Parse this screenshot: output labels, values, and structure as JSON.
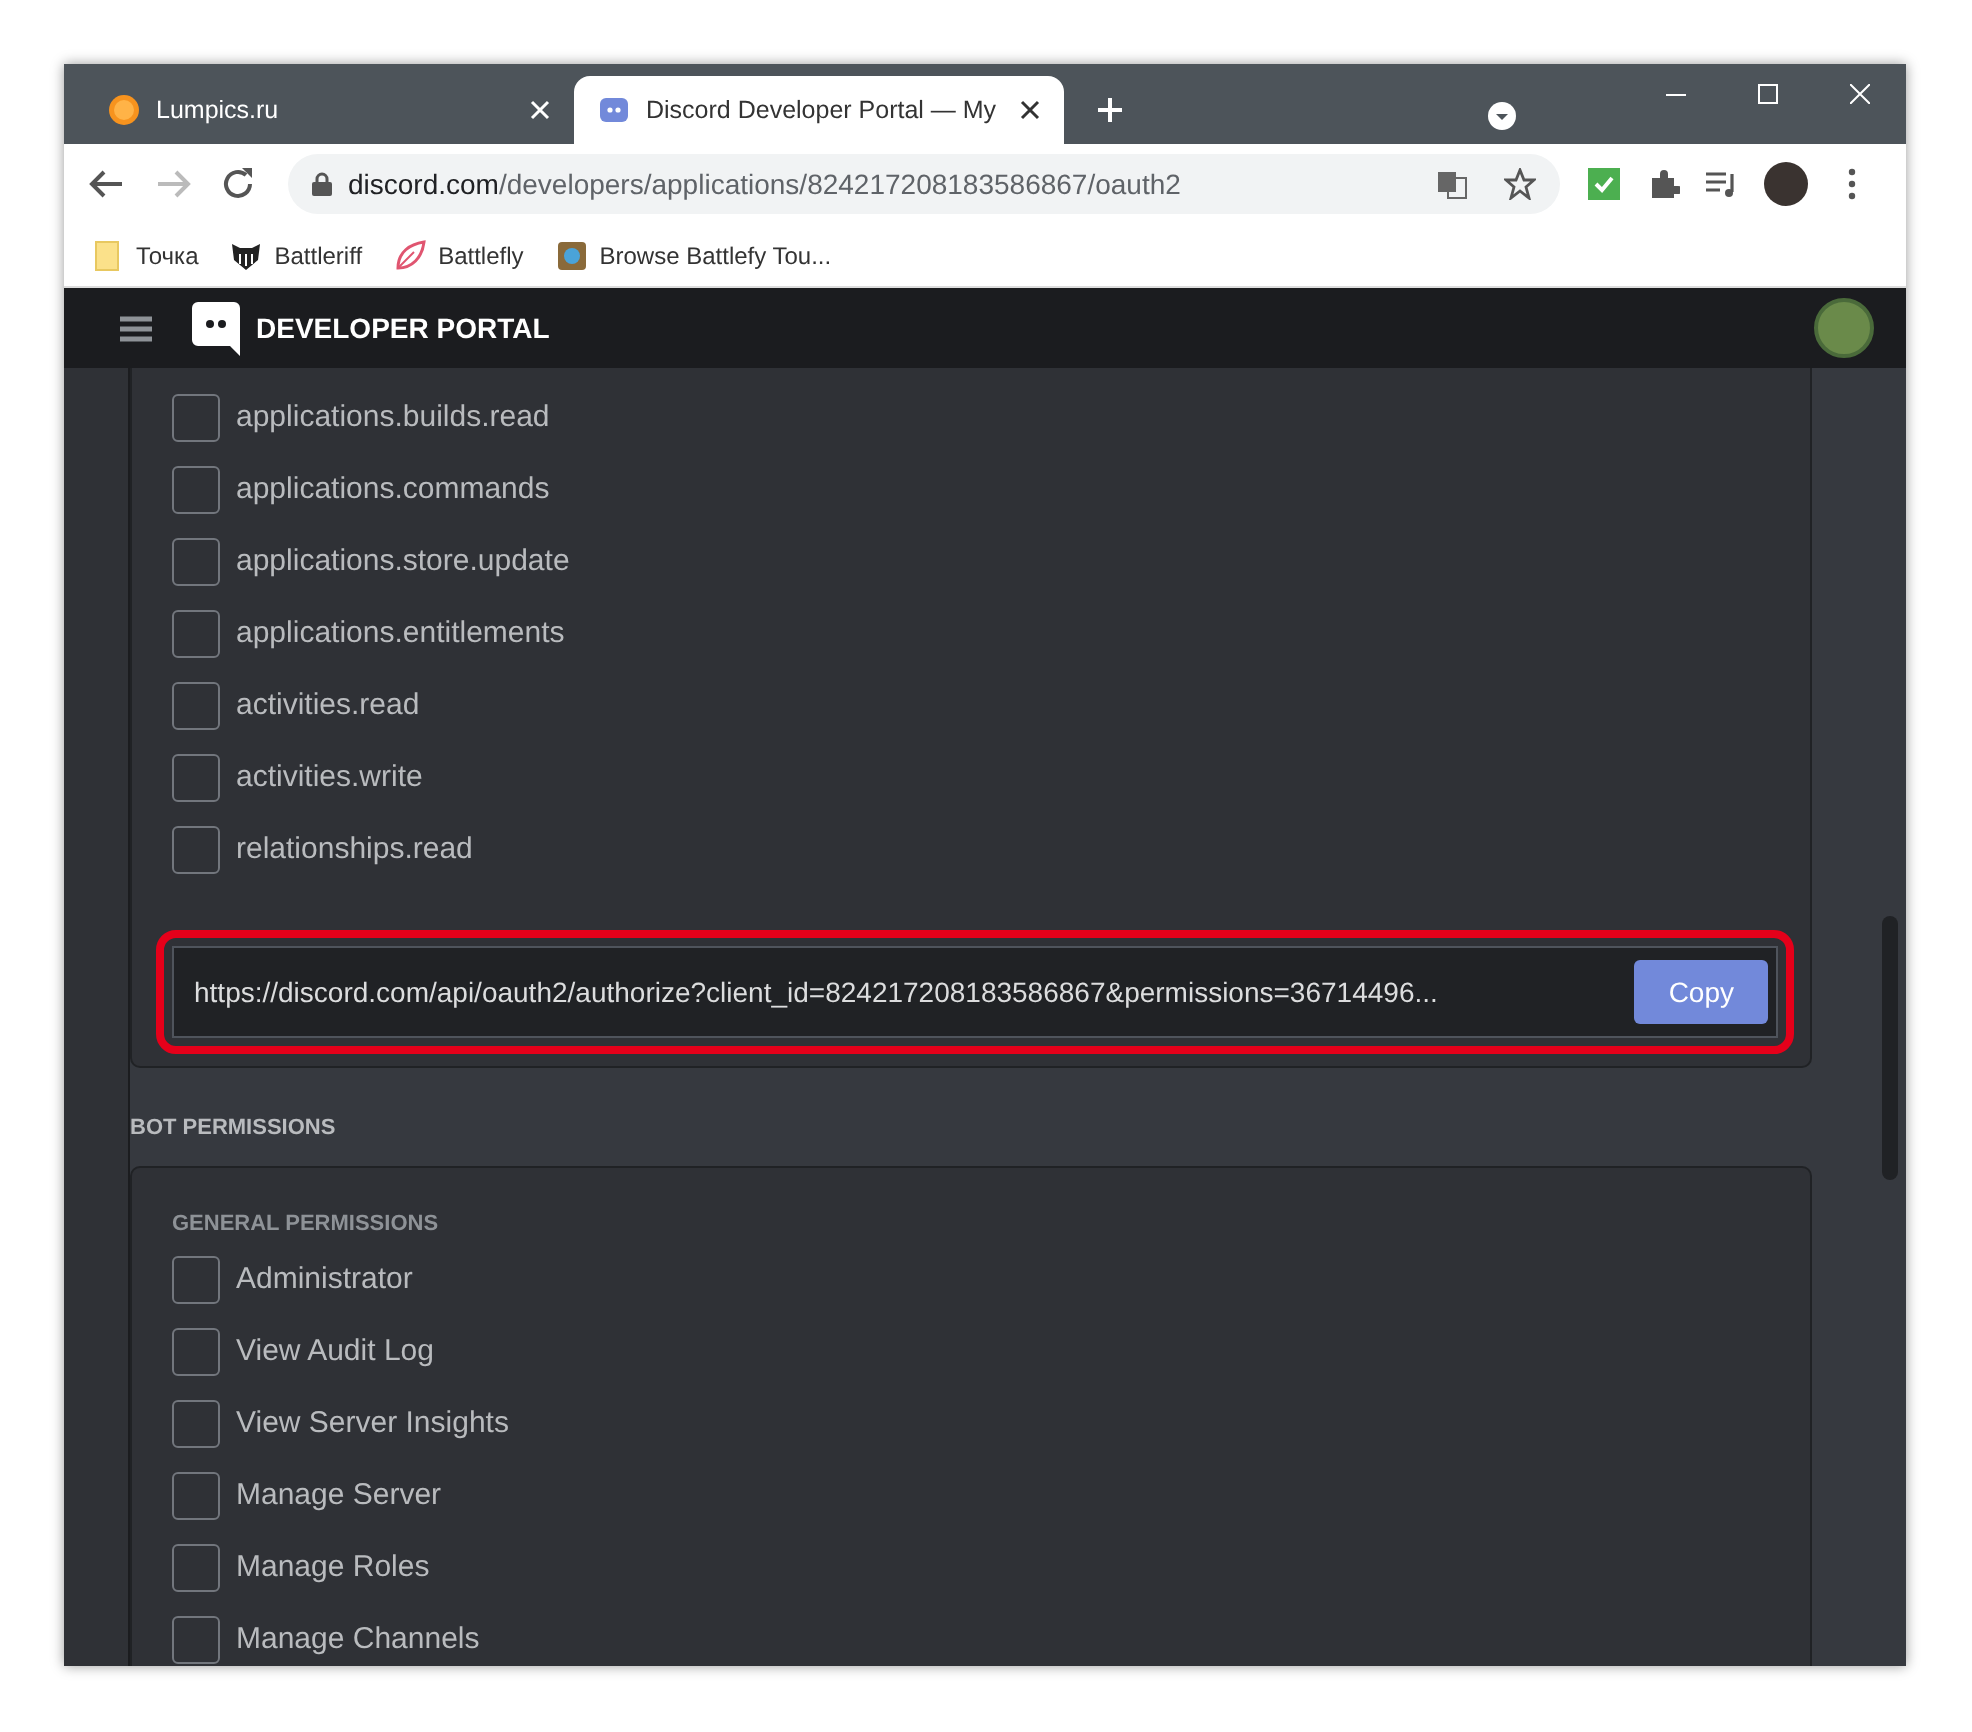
{
  "browser": {
    "tabs": [
      {
        "title": "Lumpics.ru",
        "selected": false
      },
      {
        "title": "Discord Developer Portal — My",
        "selected": true
      }
    ],
    "address": {
      "host": "discord.com",
      "path": "/developers/applications/824217208183586867/oauth2"
    },
    "bookmarks": [
      "Точка",
      "Battleriff",
      "Battlefly",
      "Browse Battlefy Tou..."
    ]
  },
  "header": {
    "title": "DEVELOPER PORTAL"
  },
  "scopes": [
    {
      "label": "applications.builds.read",
      "checked": false
    },
    {
      "label": "applications.commands",
      "checked": false
    },
    {
      "label": "applications.store.update",
      "checked": false
    },
    {
      "label": "applications.entitlements",
      "checked": false
    },
    {
      "label": "activities.read",
      "checked": false
    },
    {
      "label": "activities.write",
      "checked": false
    },
    {
      "label": "relationships.read",
      "checked": false
    }
  ],
  "generated_url": {
    "value": "https://discord.com/api/oauth2/authorize?client_id=824217208183586867&permissions=36714496...",
    "button": "Copy"
  },
  "bot_permissions": {
    "title": "BOT PERMISSIONS",
    "group_title": "GENERAL PERMISSIONS",
    "items": [
      {
        "label": "Administrator",
        "checked": false
      },
      {
        "label": "View Audit Log",
        "checked": false
      },
      {
        "label": "View Server Insights",
        "checked": false
      },
      {
        "label": "Manage Server",
        "checked": false
      },
      {
        "label": "Manage Roles",
        "checked": false
      },
      {
        "label": "Manage Channels",
        "checked": false
      }
    ]
  }
}
